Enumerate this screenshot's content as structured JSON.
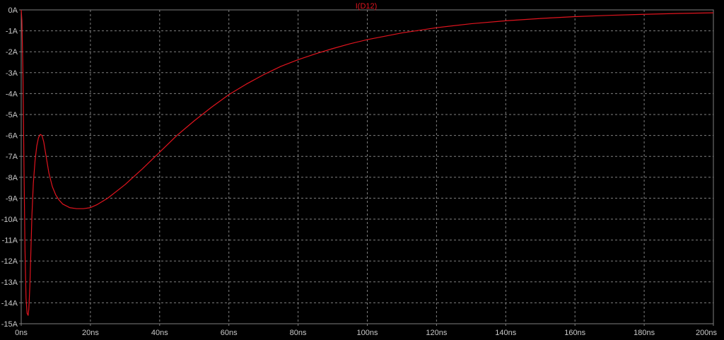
{
  "colors": {
    "background": "#000000",
    "grid": "#7f7f7f",
    "frame": "#7f7f7f",
    "tick_text": "#c8c8c8",
    "trace": "#e0141e"
  },
  "chart_data": {
    "type": "line",
    "title": "I(D12)",
    "xlabel": "",
    "ylabel": "",
    "x_unit": "ns",
    "y_unit": "A",
    "xlim": [
      0,
      200
    ],
    "ylim": [
      -15,
      0
    ],
    "grid": true,
    "legend": "none",
    "x_ticks": [
      "0ns",
      "20ns",
      "40ns",
      "60ns",
      "80ns",
      "100ns",
      "120ns",
      "140ns",
      "160ns",
      "180ns",
      "200ns"
    ],
    "y_ticks": [
      "0A",
      "-1A",
      "-2A",
      "-3A",
      "-4A",
      "-5A",
      "-6A",
      "-7A",
      "-8A",
      "-9A",
      "-10A",
      "-11A",
      "-12A",
      "-13A",
      "-14A",
      "-15A"
    ],
    "series": [
      {
        "name": "I(D12)",
        "x": [
          0,
          0.2,
          0.5,
          0.8,
          1.1,
          1.4,
          1.7,
          2.0,
          2.2,
          2.5,
          2.8,
          3.1,
          3.5,
          4.0,
          4.5,
          5.0,
          5.5,
          6.0,
          6.5,
          7.0,
          7.5,
          8.0,
          9.0,
          10.0,
          11.0,
          12.0,
          14.0,
          16.0,
          18.0,
          20.0,
          22.0,
          25.0,
          30.0,
          35.0,
          40.0,
          45.0,
          50.0,
          55.0,
          60.0,
          65.0,
          70.0,
          75.0,
          80.0,
          85.0,
          90.0,
          95.0,
          100.0,
          110.0,
          120.0,
          130.0,
          140.0,
          150.0,
          160.0,
          170.0,
          180.0,
          190.0,
          200.0
        ],
        "values": [
          0,
          -0.5,
          -3.0,
          -7.5,
          -11.5,
          -13.8,
          -14.5,
          -14.6,
          -14.3,
          -13.2,
          -11.5,
          -9.8,
          -8.3,
          -7.2,
          -6.5,
          -6.1,
          -5.95,
          -6.0,
          -6.3,
          -6.8,
          -7.3,
          -7.8,
          -8.45,
          -8.85,
          -9.1,
          -9.28,
          -9.45,
          -9.5,
          -9.5,
          -9.45,
          -9.3,
          -9.0,
          -8.35,
          -7.6,
          -6.8,
          -6.0,
          -5.3,
          -4.65,
          -4.05,
          -3.55,
          -3.1,
          -2.7,
          -2.38,
          -2.1,
          -1.85,
          -1.62,
          -1.42,
          -1.1,
          -0.85,
          -0.66,
          -0.52,
          -0.41,
          -0.32,
          -0.26,
          -0.21,
          -0.17,
          -0.14
        ]
      }
    ]
  }
}
